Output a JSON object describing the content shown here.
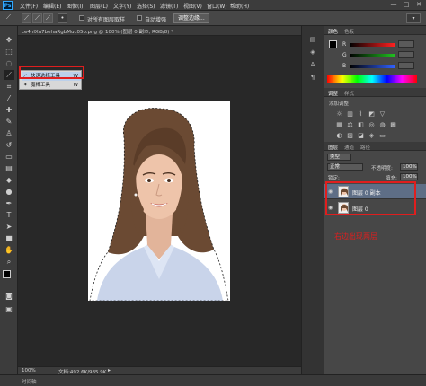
{
  "app": {
    "logo": "Ps"
  },
  "menu": [
    "文件(F)",
    "编辑(E)",
    "图像(I)",
    "图层(L)",
    "文字(Y)",
    "选择(S)",
    "滤镜(T)",
    "视图(V)",
    "窗口(W)",
    "帮助(H)"
  ],
  "window_controls": {
    "minimize": "—",
    "maximize": "□",
    "close": "✕"
  },
  "options": {
    "sample_all_label": "对所有图层取样",
    "auto_enhance_label": "自动增强",
    "refine_edge_button": "调整边缘..."
  },
  "document": {
    "tab_title": "ce4hlXu7behaRgbMuc05o.png @ 100% (图层 0 副本, RGB/8) *",
    "zoom": "100%",
    "doc_info": "文档:492.6K/985.9K"
  },
  "flyout": {
    "items": [
      {
        "label": "快速选择工具",
        "shortcut": "W"
      },
      {
        "label": "魔棒工具",
        "shortcut": "W"
      }
    ]
  },
  "bottom": {
    "tab_label": "时间轴"
  },
  "color_panel": {
    "tabs": [
      "颜色",
      "色板"
    ],
    "channels": [
      {
        "label": "R",
        "color": "#ff3030"
      },
      {
        "label": "G",
        "color": "#30c030"
      },
      {
        "label": "B",
        "color": "#3060ff"
      }
    ]
  },
  "adjust_panel": {
    "tabs": [
      "调整",
      "样式"
    ],
    "subtitle": "添加调整"
  },
  "layers_panel": {
    "tabs": [
      "图层",
      "通道",
      "路径"
    ],
    "kind_label": "类型",
    "blend_mode": "正常",
    "opacity_label": "不透明度:",
    "opacity_value": "100%",
    "lock_label": "锁定:",
    "fill_label": "填充:",
    "fill_value": "100%",
    "layers": [
      {
        "name": "图层 0 副本",
        "selected": true
      },
      {
        "name": "图层 0",
        "selected": false
      }
    ]
  },
  "annotation": "右边出现两层",
  "colors": {
    "highlight_red": "#e01e1e",
    "ps_blue": "#31a8ff"
  }
}
